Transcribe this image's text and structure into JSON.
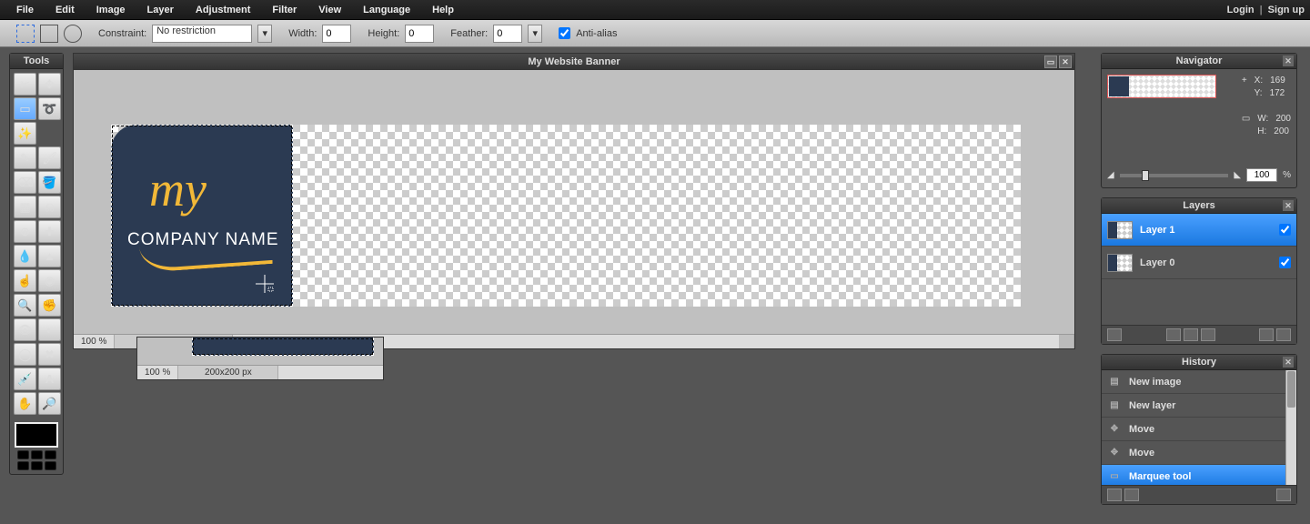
{
  "menubar": {
    "items": [
      "File",
      "Edit",
      "Image",
      "Layer",
      "Adjustment",
      "Filter",
      "View",
      "Language",
      "Help"
    ],
    "login": "Login",
    "signup": "Sign up"
  },
  "options": {
    "constraint_label": "Constraint:",
    "constraint_value": "No restriction",
    "width_label": "Width:",
    "width_value": "0",
    "height_label": "Height:",
    "height_value": "0",
    "feather_label": "Feather:",
    "feather_value": "0",
    "antialias_label": "Anti-alias",
    "antialias_checked": true
  },
  "tools_title": "Tools",
  "documents": [
    {
      "title": "My Website Banner",
      "zoom": "100",
      "zoom_unit": "%",
      "dimensions": "1000x200 px",
      "logo_my": "my",
      "logo_company": "COMPANY NAME"
    },
    {
      "title": "",
      "zoom": "100",
      "zoom_unit": "%",
      "dimensions": "200x200 px"
    }
  ],
  "navigator": {
    "title": "Navigator",
    "x_label": "X:",
    "x_value": "169",
    "y_label": "Y:",
    "y_value": "172",
    "w_label": "W:",
    "w_value": "200",
    "h_label": "H:",
    "h_value": "200",
    "zoom_value": "100",
    "zoom_unit": "%"
  },
  "layers": {
    "title": "Layers",
    "items": [
      {
        "name": "Layer 1",
        "visible": true,
        "selected": true
      },
      {
        "name": "Layer 0",
        "visible": true,
        "selected": false
      }
    ]
  },
  "history": {
    "title": "History",
    "items": [
      {
        "label": "New image",
        "selected": false,
        "icon": "doc"
      },
      {
        "label": "New layer",
        "selected": false,
        "icon": "doc"
      },
      {
        "label": "Move",
        "selected": false,
        "icon": "move"
      },
      {
        "label": "Move",
        "selected": false,
        "icon": "move"
      },
      {
        "label": "Marquee tool",
        "selected": true,
        "icon": "marquee"
      }
    ]
  }
}
